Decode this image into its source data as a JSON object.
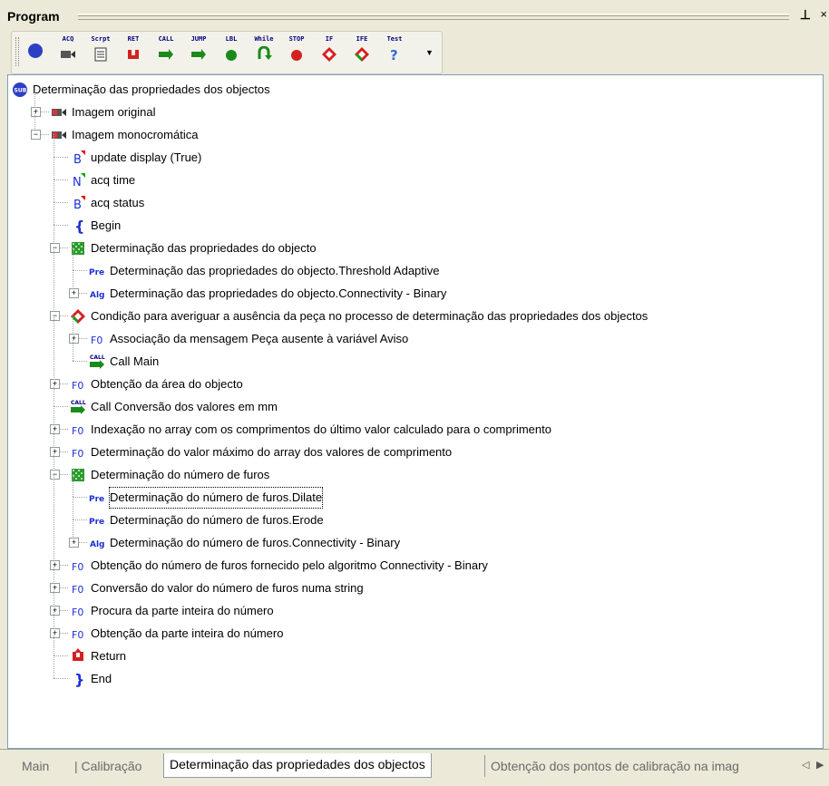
{
  "panel": {
    "title": "Program",
    "pin_glyph": "⊥",
    "close_glyph": "×"
  },
  "toolbar": {
    "buttons": [
      {
        "label": "SUB",
        "icon": "sub-icon"
      },
      {
        "label": "ACQ",
        "icon": "camera-icon"
      },
      {
        "label": "Scrpt",
        "icon": "script-icon"
      },
      {
        "label": "RET",
        "icon": "return-icon"
      },
      {
        "label": "CALL",
        "icon": "call-icon"
      },
      {
        "label": "JUMP",
        "icon": "jump-icon"
      },
      {
        "label": "LBL",
        "icon": "label-icon"
      },
      {
        "label": "While",
        "icon": "while-icon"
      },
      {
        "label": "STOP",
        "icon": "stop-icon"
      },
      {
        "label": "IF",
        "icon": "if-icon"
      },
      {
        "label": "IFE",
        "icon": "ife-icon"
      },
      {
        "label": "Test",
        "icon": "test-icon"
      }
    ],
    "dropdown_glyph": "▼"
  },
  "tree": [
    {
      "level": 0,
      "expander": "",
      "icon": "sub",
      "text": "Determinação das propriedades dos objectos"
    },
    {
      "level": 1,
      "expander": "+",
      "icon": "cam",
      "text": "Imagem original"
    },
    {
      "level": 1,
      "expander": "−",
      "icon": "cam",
      "text": "Imagem monocromática"
    },
    {
      "level": 2,
      "expander": "",
      "icon": "B",
      "text": "update display (True)"
    },
    {
      "level": 2,
      "expander": "",
      "icon": "N",
      "text": "acq time"
    },
    {
      "level": 2,
      "expander": "",
      "icon": "B",
      "text": "acq status"
    },
    {
      "level": 2,
      "expander": "",
      "icon": "begin",
      "text": "Begin"
    },
    {
      "level": 2,
      "expander": "−",
      "icon": "grid",
      "text": "Determinação das propriedades do objecto"
    },
    {
      "level": 3,
      "expander": "",
      "icon": "Pre",
      "text": "Determinação das propriedades do objecto.Threshold Adaptive"
    },
    {
      "level": 3,
      "expander": "+",
      "icon": "Alg",
      "text": "Determinação das propriedades do objecto.Connectivity - Binary"
    },
    {
      "level": 2,
      "expander": "−",
      "icon": "diamond",
      "text": "Condição para averiguar a ausência da peça no processo de determinação das propriedades dos objectos"
    },
    {
      "level": 3,
      "expander": "+",
      "icon": "F0",
      "text": "Associação da mensagem Peça ausente à variável Aviso"
    },
    {
      "level": 3,
      "expander": "",
      "icon": "call",
      "text": "Call Main"
    },
    {
      "level": 2,
      "expander": "+",
      "icon": "F0",
      "text": "Obtenção da área do objecto"
    },
    {
      "level": 2,
      "expander": "",
      "icon": "call",
      "text": "Call Conversão dos valores em mm"
    },
    {
      "level": 2,
      "expander": "+",
      "icon": "F0",
      "text": "Indexação no array com os comprimentos do último valor calculado para o comprimento"
    },
    {
      "level": 2,
      "expander": "+",
      "icon": "F0",
      "text": "Determinação do valor máximo do array dos valores de comprimento"
    },
    {
      "level": 2,
      "expander": "−",
      "icon": "grid",
      "text": "Determinação do número de furos"
    },
    {
      "level": 3,
      "expander": "",
      "icon": "Pre",
      "text": "Determinação do número de furos.Dilate",
      "selected": true
    },
    {
      "level": 3,
      "expander": "",
      "icon": "Pre",
      "text": "Determinação do número de furos.Erode"
    },
    {
      "level": 3,
      "expander": "+",
      "icon": "Alg",
      "text": "Determinação do número de furos.Connectivity - Binary"
    },
    {
      "level": 2,
      "expander": "+",
      "icon": "F0",
      "text": "Obtenção do número de furos fornecido pelo algoritmo Connectivity - Binary"
    },
    {
      "level": 2,
      "expander": "+",
      "icon": "F0",
      "text": "Conversão do valor do número de furos numa string"
    },
    {
      "level": 2,
      "expander": "+",
      "icon": "F0",
      "text": "Procura da parte inteira do número"
    },
    {
      "level": 2,
      "expander": "+",
      "icon": "F0",
      "text": "Obtenção da parte inteira do número"
    },
    {
      "level": 2,
      "expander": "",
      "icon": "return",
      "text": "Return"
    },
    {
      "level": 2,
      "expander": "",
      "icon": "end",
      "text": "End"
    }
  ],
  "tabs": [
    {
      "label": "Main",
      "active": false
    },
    {
      "label": "Calibração",
      "active": false
    },
    {
      "label": "Determinação das propriedades dos objectos",
      "active": true
    },
    {
      "label": "Obtenção dos pontos de calibração na imag",
      "active": false
    }
  ],
  "tab_nav": {
    "left": "◁",
    "right": "▶"
  }
}
